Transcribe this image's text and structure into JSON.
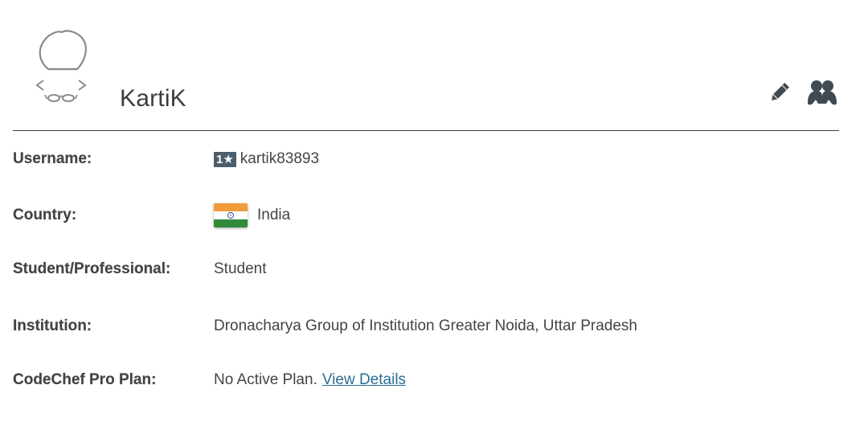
{
  "profile": {
    "name": "KartiK",
    "icons": {
      "avatar": "chef-avatar-icon",
      "edit": "pencil-icon",
      "friends": "users-icon"
    }
  },
  "details": {
    "username": {
      "label": "Username:",
      "badge": "1★",
      "value": "kartik83893"
    },
    "country": {
      "label": "Country:",
      "flag_icon": "india-flag-icon",
      "value": "India"
    },
    "occupation": {
      "label": "Student/Professional:",
      "value": "Student"
    },
    "institution": {
      "label": "Institution:",
      "value": "Dronacharya Group of Institution Greater Noida, Uttar Pradesh"
    },
    "pro_plan": {
      "label": "CodeChef Pro Plan:",
      "value": "No Active Plan.",
      "link": "View Details"
    }
  },
  "colors": {
    "badge_bg": "#4c5e6b",
    "link": "#2a6d94",
    "divider": "#3b3b3b",
    "icon": "#3f4a52"
  }
}
